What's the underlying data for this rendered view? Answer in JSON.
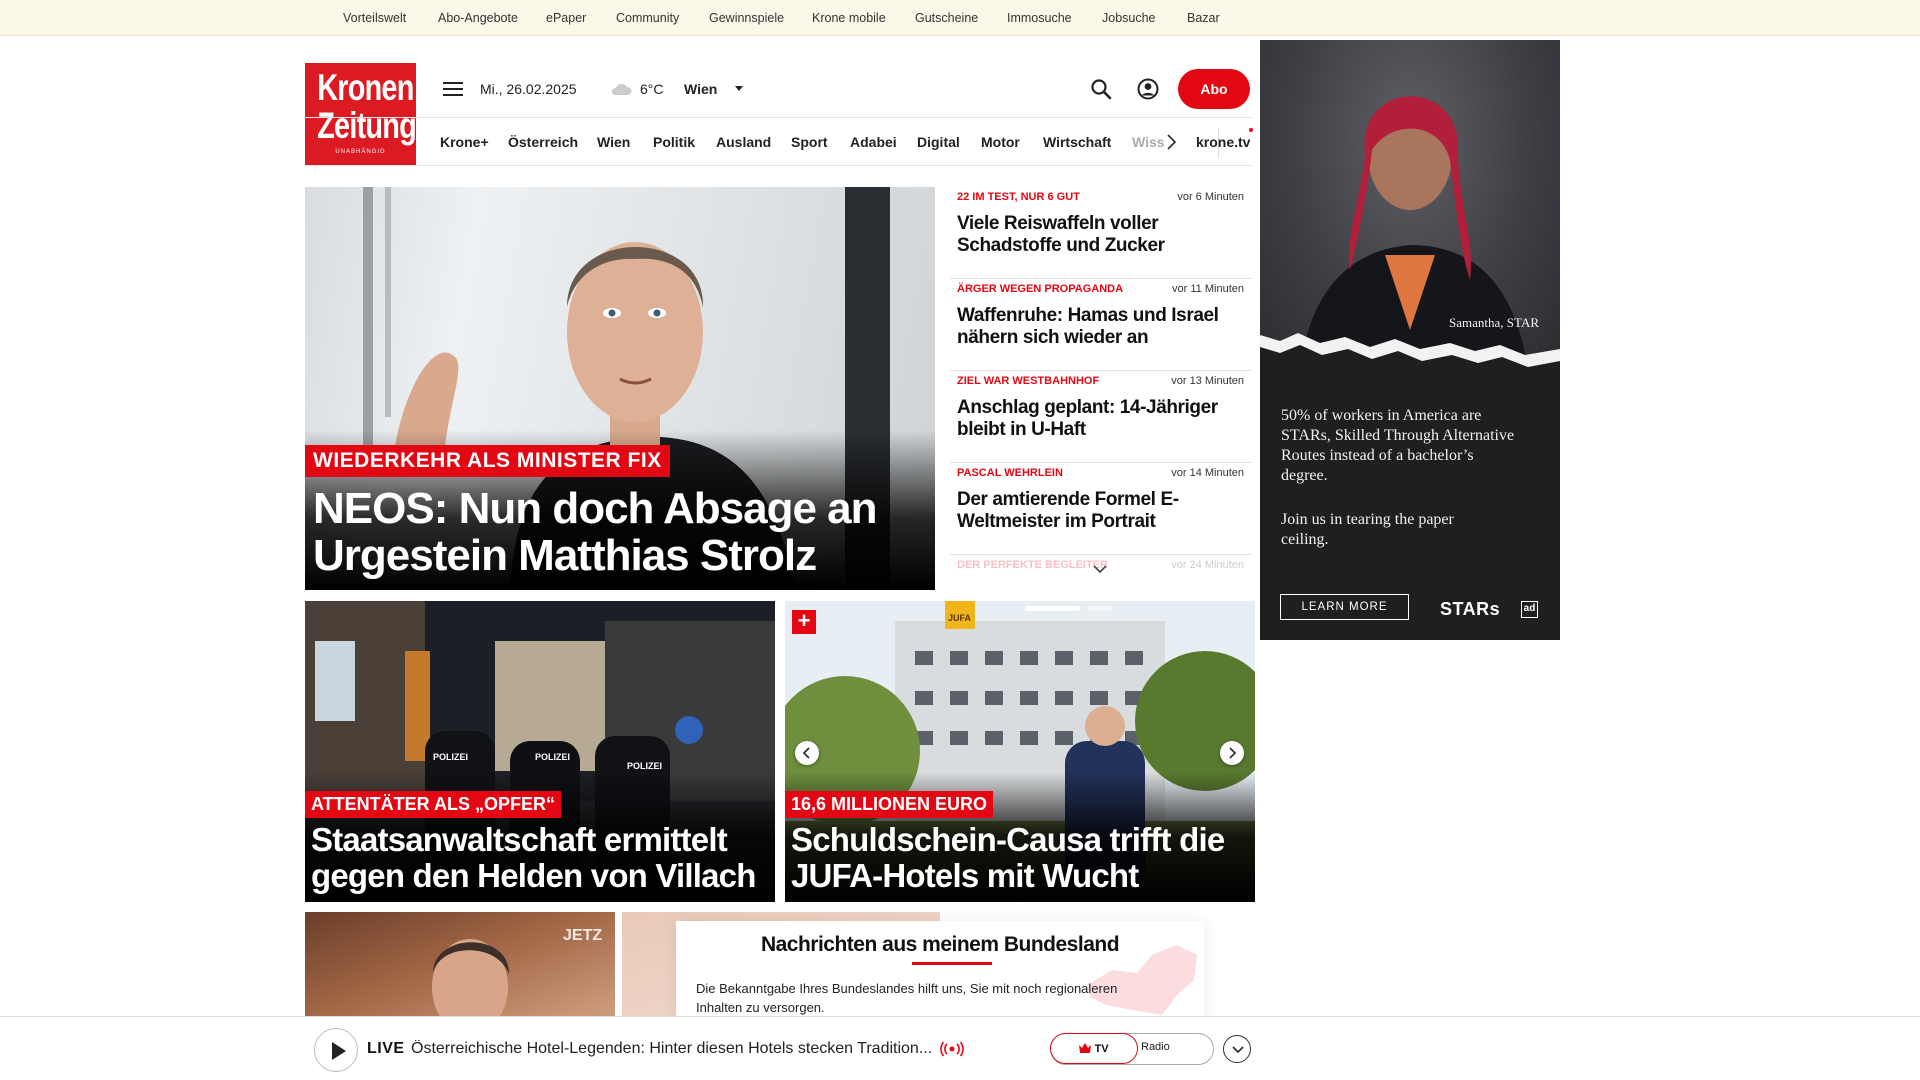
{
  "topbar": {
    "links": [
      "Vorteilswelt",
      "Abo-Angebote",
      "ePaper",
      "Community",
      "Gewinnspiele",
      "Krone mobile",
      "Gutscheine",
      "Immosuche",
      "Jobsuche",
      "Bazar"
    ]
  },
  "logo": {
    "line1": "Kronen",
    "line2": "Zeitung",
    "tagline": "UNABHÄNGIG"
  },
  "header": {
    "date": "Mi., 26.02.2025",
    "temperature": "6°C",
    "city": "Wien",
    "abo_label": "Abo",
    "icons": [
      "menu-icon",
      "cloud-icon",
      "search-icon",
      "user-icon"
    ]
  },
  "nav": {
    "items": [
      "Krone+",
      "Österreich",
      "Wien",
      "Politik",
      "Ausland",
      "Sport",
      "Adabei",
      "Digital",
      "Motor",
      "Wirtschaft",
      "Wiss"
    ],
    "tv": "krone.tv"
  },
  "hero": {
    "kicker": "WIEDERKEHR ALS MINISTER FIX",
    "title": "NEOS: Nun doch Absage an Urgestein Matthias Strolz"
  },
  "sidelist": [
    {
      "kicker": "22 IM TEST, NUR 6 GUT",
      "time": "vor 6 Minuten",
      "title": "Viele Reiswaffeln voller Schadstoffe und Zucker"
    },
    {
      "kicker": "ÄRGER WEGEN PROPAGANDA",
      "time": "vor 11 Minuten",
      "title": "Waffenruhe: Hamas und Israel nähern sich wieder an"
    },
    {
      "kicker": "ZIEL WAR WESTBAHNHOF",
      "time": "vor 13 Minuten",
      "title": "Anschlag geplant: 14-Jähriger bleibt in U-Haft"
    },
    {
      "kicker": "PASCAL WEHRLEIN",
      "time": "vor 14 Minuten",
      "title": "Der amtierende Formel E-Weltmeister im Portrait"
    },
    {
      "kicker": "DER PERFEKTE BEGLEITER",
      "time": "vor 24 Minuten",
      "title": ""
    }
  ],
  "cards": [
    {
      "kicker": "ATTENTÄTER ALS „OPFER“",
      "title": "Staatsanwaltschaft ermittelt gegen den Helden von Villach",
      "signs": [
        "POLIZEI",
        "POLIZEI",
        "POLIZEI"
      ]
    },
    {
      "kicker": "16,6 MILLIONEN EURO",
      "title": "Schuldschein-Causa trifft die JUFA-Hotels mit Wucht",
      "plus": "+",
      "sign": "JUFA"
    }
  ],
  "thumb1": {
    "overlay": "JETZ"
  },
  "bundesland": {
    "title": "Nachrichten aus meinem Bundesland",
    "text": "Die Bekanntgabe Ihres Bundeslandes hilft uns, Sie mit noch regionaleren Inhalten zu versorgen."
  },
  "ad": {
    "caption": "Samantha, STAR",
    "copy1": "50% of workers in America are STARs, Skilled Through Alternative Routes instead of a bachelor’s degree.",
    "copy2": "Join us in tearing the paper ceiling.",
    "button": "LEARN MORE",
    "brand": "STARs",
    "adchoice": "ad"
  },
  "livebar": {
    "label": "LIVE",
    "text": "Österreichische Hotel-Legenden: Hinter diesen Hotels stecken Tradition...",
    "tv": "TV",
    "radio": "Radio"
  },
  "colors": {
    "brand_red": "#e30613",
    "topbar_bg": "#fbf7e9"
  }
}
